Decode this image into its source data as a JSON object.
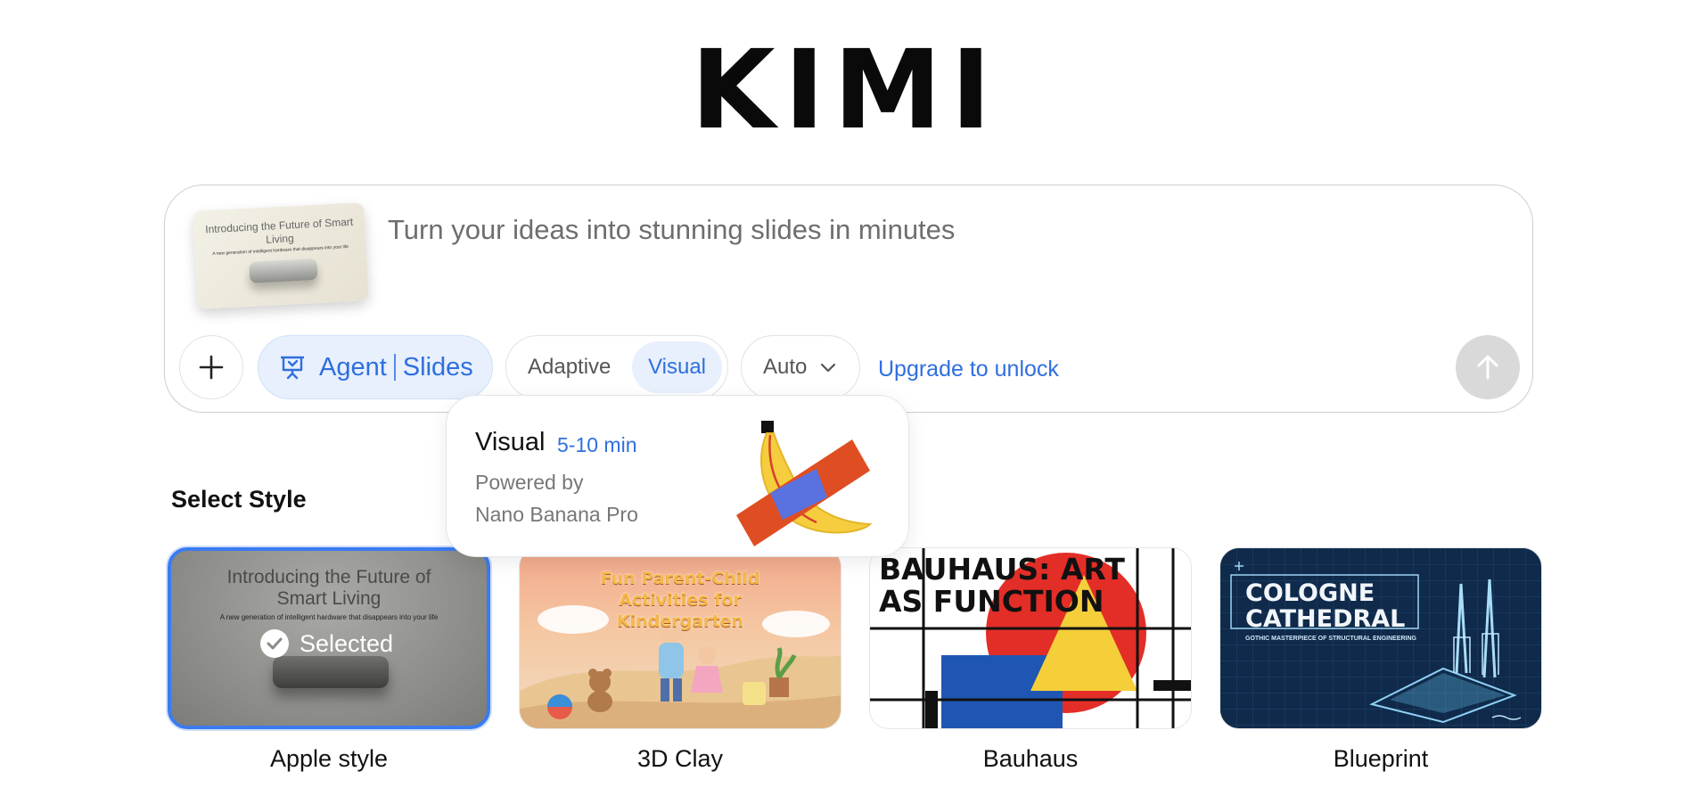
{
  "logo": {
    "text": "KIMI"
  },
  "composer": {
    "placeholder": "Turn your ideas into stunning slides in minutes",
    "attachment": {
      "title": "Introducing the Future of Smart Living",
      "subtitle": "A new generation of intelligent hardware that disappears into your life"
    },
    "add_icon": "plus-icon",
    "agent": {
      "icon": "presentation-icon",
      "label": "Agent",
      "mode": "Slides"
    },
    "render_mode": {
      "options": [
        "Adaptive",
        "Visual"
      ],
      "selected": "Visual"
    },
    "model_select": {
      "value": "Auto",
      "icon": "chevron-down-icon"
    },
    "upgrade_link": "Upgrade to unlock",
    "send_icon": "arrow-up-icon"
  },
  "popup": {
    "title": "Visual",
    "duration": "5-10 min",
    "powered_by_label": "Powered by",
    "engine": "Nano Banana Pro"
  },
  "styles": {
    "title": "Select Style",
    "selected_label": "Selected",
    "items": [
      {
        "label": "Apple style",
        "selected": true,
        "heading": "Introducing the Future of Smart Living",
        "sub": "A new generation of intelligent hardware that disappears into your life"
      },
      {
        "label": "3D Clay",
        "selected": false,
        "heading": "Fun Parent-Child Activities for Kindergarten"
      },
      {
        "label": "Bauhaus",
        "selected": false,
        "heading": "BAUHAUS: ART AS FUNCTION"
      },
      {
        "label": "Blueprint",
        "selected": false,
        "heading": "COLOGNE CATHEDRAL",
        "sub": "GOTHIC MASTERPIECE OF STRUCTURAL ENGINEERING"
      }
    ]
  },
  "colors": {
    "accent": "#2f6fde",
    "accent_bg": "#e8f0fd",
    "selected_border": "#3b7bf0"
  }
}
